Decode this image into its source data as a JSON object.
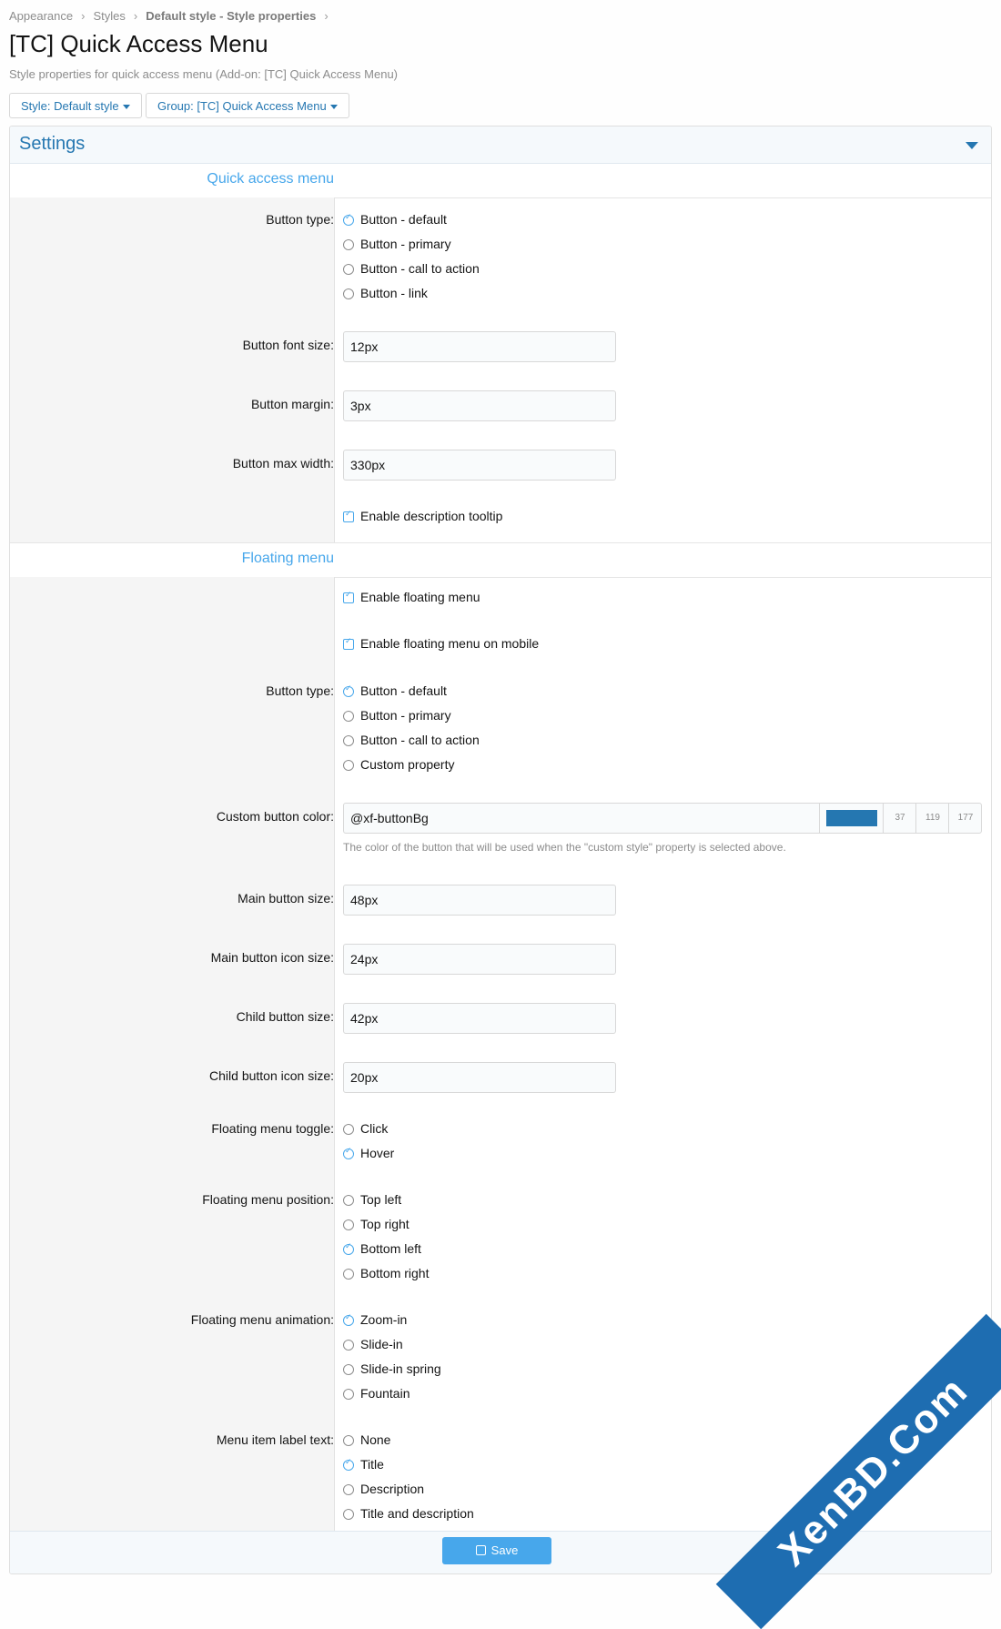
{
  "breadcrumb": {
    "appearance": "Appearance",
    "styles": "Styles",
    "style_props": "Default style - Style properties"
  },
  "title": "[TC] Quick Access Menu",
  "description": "Style properties for quick access menu (Add-on: [TC] Quick Access Menu)",
  "filters": {
    "style": "Style: Default style",
    "group": "Group: [TC] Quick Access Menu"
  },
  "block_title": "Settings",
  "qam": {
    "section": "Quick access menu",
    "button_type": {
      "label": "Button type:",
      "options": [
        "Button - default",
        "Button - primary",
        "Button - call to action",
        "Button - link"
      ],
      "selected": 0
    },
    "font_size": {
      "label": "Button font size:",
      "value": "12px"
    },
    "margin": {
      "label": "Button margin:",
      "value": "3px"
    },
    "max_width": {
      "label": "Button max width:",
      "value": "330px"
    },
    "tooltip": "Enable description tooltip"
  },
  "floating": {
    "section": "Floating menu",
    "enable": "Enable floating menu",
    "enable_mobile": "Enable floating menu on mobile",
    "button_type": {
      "label": "Button type:",
      "options": [
        "Button - default",
        "Button - primary",
        "Button - call to action",
        "Custom property"
      ],
      "selected": 0
    },
    "custom_color": {
      "label": "Custom button color:",
      "value": "@xf-buttonBg",
      "r": "37",
      "g": "119",
      "b": "177",
      "swatch": "#2577b1",
      "hint": "The color of the button that will be used when the \"custom style\" property is selected above."
    },
    "main_size": {
      "label": "Main button size:",
      "value": "48px"
    },
    "main_icon": {
      "label": "Main button icon size:",
      "value": "24px"
    },
    "child_size": {
      "label": "Child button size:",
      "value": "42px"
    },
    "child_icon": {
      "label": "Child button icon size:",
      "value": "20px"
    },
    "toggle": {
      "label": "Floating menu toggle:",
      "options": [
        "Click",
        "Hover"
      ],
      "selected": 1
    },
    "position": {
      "label": "Floating menu position:",
      "options": [
        "Top left",
        "Top right",
        "Bottom left",
        "Bottom right"
      ],
      "selected": 2
    },
    "animation": {
      "label": "Floating menu animation:",
      "options": [
        "Zoom-in",
        "Slide-in",
        "Slide-in spring",
        "Fountain"
      ],
      "selected": 0
    },
    "label_text": {
      "label": "Menu item label text:",
      "options": [
        "None",
        "Title",
        "Description",
        "Title and description"
      ],
      "selected": 1
    }
  },
  "save": "Save",
  "watermark": "XenBD.Com"
}
